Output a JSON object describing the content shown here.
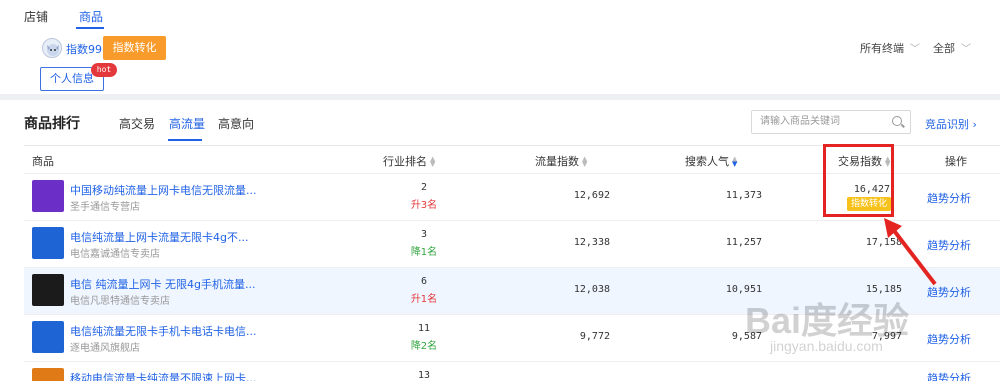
{
  "top_tabs": [
    "店铺",
    "商品"
  ],
  "brand_name": "指数99",
  "index_convert_btn": "指数转化",
  "terminal_dropdown": "所有终端",
  "all_dropdown": "全部",
  "personal_info_btn": "个人信息",
  "hot_badge": "hot",
  "section_title": "商品排行",
  "sub_tabs": [
    "高交易",
    "高流量",
    "高意向"
  ],
  "search_placeholder": "请输入商品关键词",
  "competitor_link": "竞品识别",
  "columns": {
    "product": "商品",
    "rank": "行业排名",
    "traffic": "流量指数",
    "search": "搜索人气",
    "trade": "交易指数",
    "action": "操作"
  },
  "rows": [
    {
      "name": "中国移动纯流量上网卡电信无限流量...",
      "shop": "圣手通信专营店",
      "rank": "2",
      "change": "升3名",
      "change_dir": "up",
      "traffic": "12,692",
      "search": "11,373",
      "trade": "16,427",
      "badge": "指数转化",
      "action": "趋势分析",
      "thumb_color": "#6b2fc7"
    },
    {
      "name": "电信纯流量上网卡流量无限卡4g不...",
      "shop": "电信嘉诚通信专卖店",
      "rank": "3",
      "change": "降1名",
      "change_dir": "down",
      "traffic": "12,338",
      "search": "11,257",
      "trade": "17,158",
      "badge": "",
      "action": "趋势分析",
      "thumb_color": "#1f64d4"
    },
    {
      "name": "电信 纯流量上网卡 无限4g手机流量...",
      "shop": "电信凡思特通信专卖店",
      "rank": "6",
      "change": "升1名",
      "change_dir": "up",
      "traffic": "12,038",
      "search": "10,951",
      "trade": "15,185",
      "badge": "",
      "action": "趋势分析",
      "thumb_color": "#1b1b1b"
    },
    {
      "name": "电信纯流量无限卡手机卡电话卡电信...",
      "shop": "逐电通风旗舰店",
      "rank": "11",
      "change": "降2名",
      "change_dir": "down",
      "traffic": "9,772",
      "search": "9,587",
      "trade": "7,997",
      "badge": "",
      "action": "趋势分析",
      "thumb_color": "#1f64d4"
    },
    {
      "name": "移动电信流量卡纯流量不限速上网卡...",
      "shop": "",
      "rank": "13",
      "change": "",
      "change_dir": "",
      "traffic": "",
      "search": "",
      "trade": "",
      "badge": "",
      "action": "趋势分析",
      "thumb_color": "#e07a16"
    }
  ],
  "watermark": "Bai度经验",
  "watermark_sub": "jingyan.baidu.com",
  "accent_color": "#2062e6",
  "highlight_color": "#e32421"
}
